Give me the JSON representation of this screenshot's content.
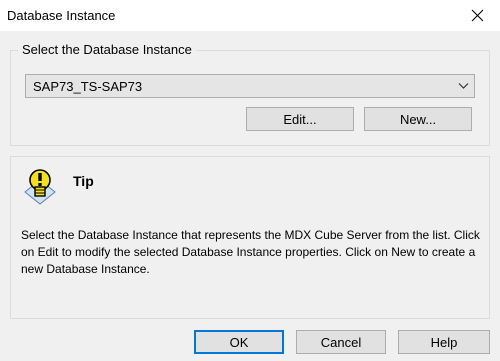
{
  "window": {
    "title": "Database Instance",
    "close_icon": "close-icon"
  },
  "selection": {
    "group_label": "Select the Database Instance",
    "selected_value": "SAP73_TS-SAP73",
    "edit_label": "Edit...",
    "new_label": "New..."
  },
  "tip": {
    "icon": "lightbulb-icon",
    "title": "Tip",
    "text": "Select the Database Instance that represents the MDX Cube Server from the list. Click on Edit to modify the selected Database Instance properties. Click on New to create a new Database Instance."
  },
  "footer": {
    "ok_label": "OK",
    "cancel_label": "Cancel",
    "help_label": "Help"
  },
  "colors": {
    "background": "#f0f0f0",
    "default_button_border": "#0078d7",
    "bulb_yellow": "#f4e11a"
  }
}
